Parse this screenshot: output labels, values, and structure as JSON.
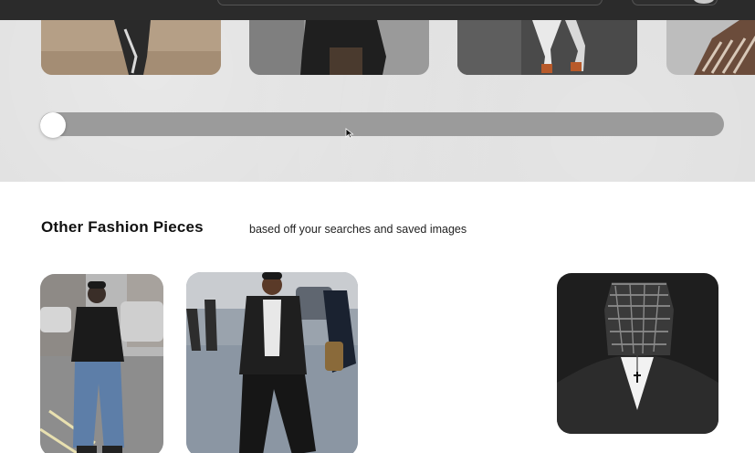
{
  "section": {
    "title": "Other Fashion Pieces",
    "subtitle": "based off your searches and saved images"
  },
  "gallery": {
    "cards": [
      {
        "icon": "fashion-photo-1"
      },
      {
        "icon": "fashion-photo-2"
      },
      {
        "icon": "fashion-photo-3"
      },
      {
        "icon": "fashion-photo-4"
      }
    ],
    "slider_position": 0.0
  },
  "recommendations": [
    {
      "icon": "street-style-photo-1"
    },
    {
      "icon": "street-style-photo-2"
    },
    {
      "icon": "masked-portrait-photo"
    }
  ],
  "colors": {
    "topbar": "#2b2b2b",
    "gallery_bg": "#dcdcdc",
    "slider_track": "#9b9b9b",
    "slider_thumb": "#ffffff"
  }
}
